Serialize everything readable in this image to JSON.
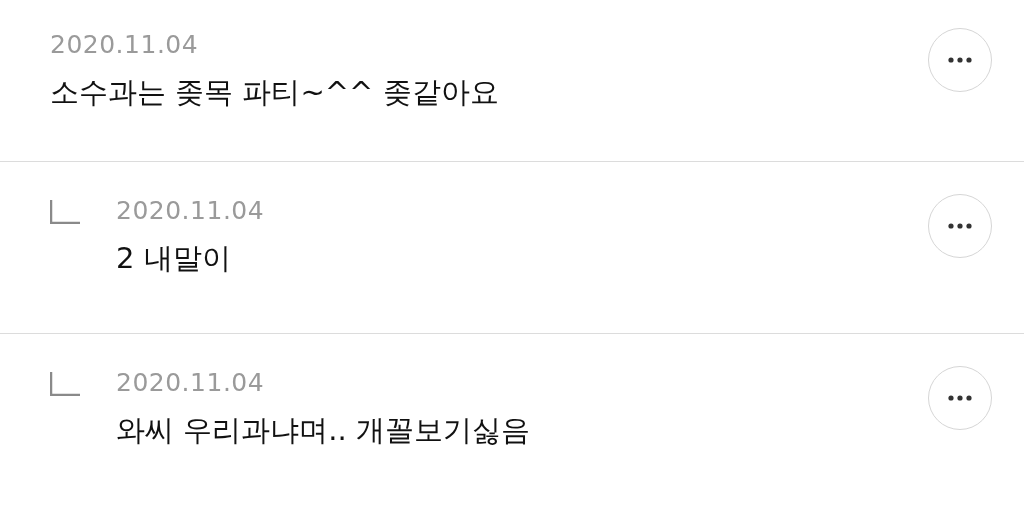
{
  "comments": [
    {
      "date": "2020.11.04",
      "text": "소수과는 좆목 파티~^^ 좆같아요",
      "children": [
        {
          "date": "2020.11.04",
          "text": "2 내말이"
        },
        {
          "date": "2020.11.04",
          "text": "와씨 우리과냐며.. 개꼴보기싫음"
        }
      ]
    }
  ]
}
